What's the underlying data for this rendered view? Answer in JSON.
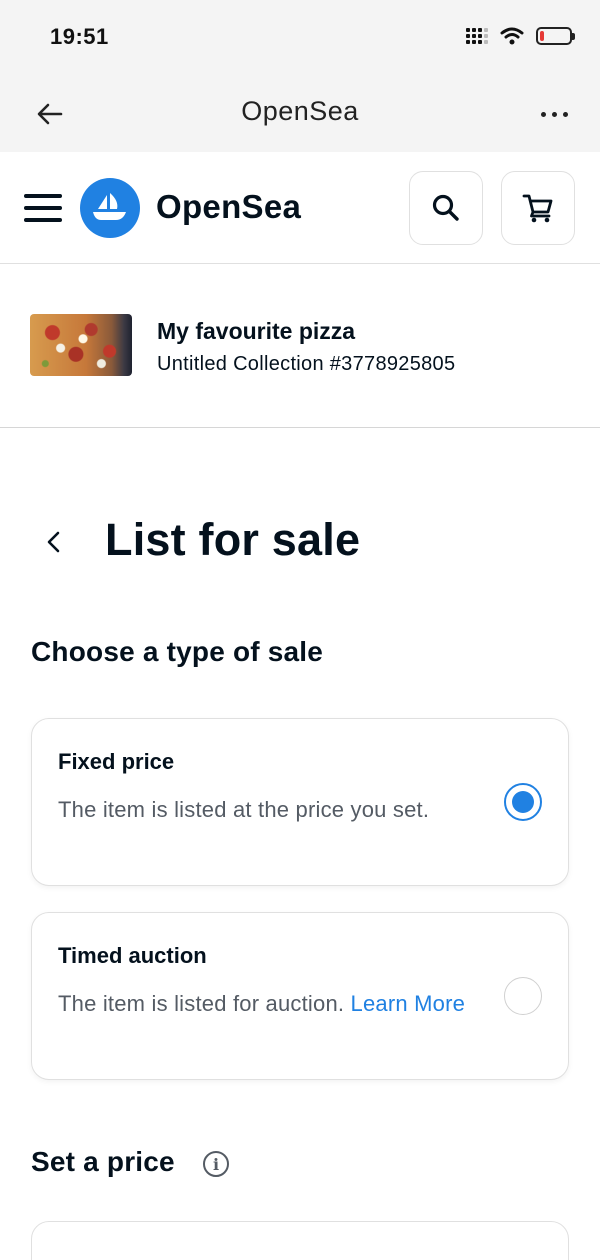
{
  "status_bar": {
    "time": "19:51",
    "battery_level": 0.15,
    "battery_color": "#e53935"
  },
  "browser": {
    "title": "OpenSea",
    "back_icon": "arrow-left-icon",
    "more_icon": "more-horizontal-icon"
  },
  "header": {
    "brand": "OpenSea",
    "brand_color": "#2081e2",
    "menu_icon": "hamburger-icon",
    "search_icon": "search-icon",
    "cart_icon": "cart-icon"
  },
  "item": {
    "name": "My favourite pizza",
    "collection": "Untitled Collection #3778925805"
  },
  "page": {
    "title": "List for sale",
    "back_icon": "chevron-left-icon"
  },
  "sale_type": {
    "heading": "Choose a type of sale",
    "options": [
      {
        "title": "Fixed price",
        "description": "The item is listed at the price you set.",
        "selected": true
      },
      {
        "title": "Timed auction",
        "description": "The item is listed for auction.",
        "link": "Learn More",
        "selected": false
      }
    ]
  },
  "price": {
    "heading": "Set a price",
    "info_icon": "info-icon",
    "info_glyph": "i"
  },
  "colors": {
    "accent": "#2081e2",
    "text": "#04111d",
    "muted": "#545b64"
  }
}
